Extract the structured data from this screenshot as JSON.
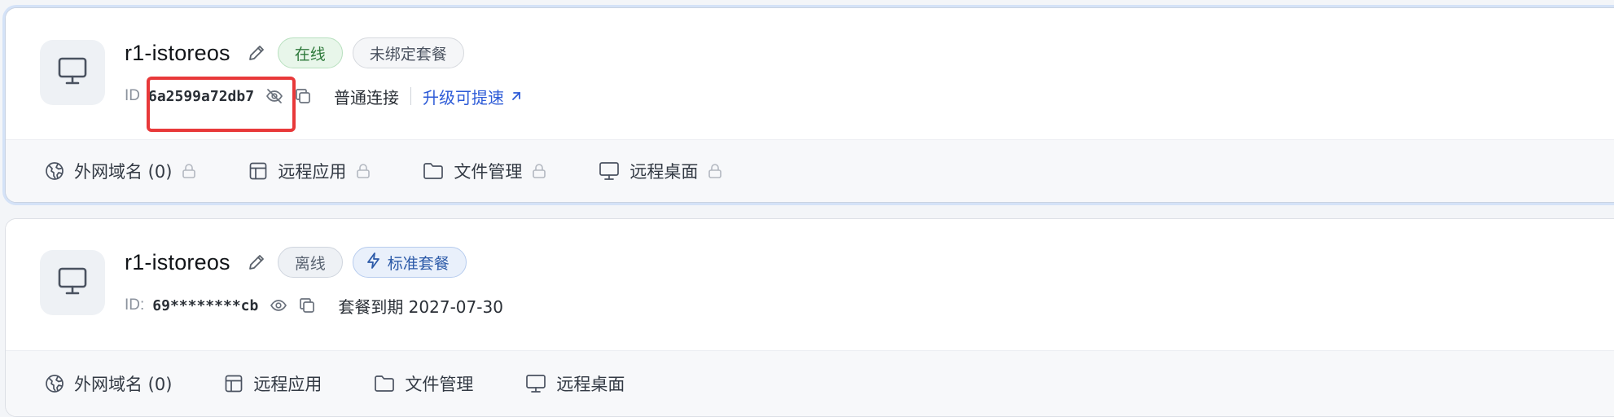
{
  "devices": [
    {
      "name": "r1-istoreos",
      "status": "在线",
      "plan_badge": "未绑定套餐",
      "id_label": "ID",
      "id_value": "6a2599a72db7",
      "connection": "普通连接",
      "upgrade": "升级可提速",
      "actions": {
        "domain": "外网域名 (0)",
        "remote_app": "远程应用",
        "file_manager": "文件管理",
        "remote_desktop": "远程桌面"
      }
    },
    {
      "name": "r1-istoreos",
      "status": "离线",
      "plan_badge": "标准套餐",
      "id_label": "ID:",
      "id_value": "69********cb",
      "expire": "套餐到期 2027-07-30",
      "actions": {
        "domain": "外网域名 (0)",
        "remote_app": "远程应用",
        "file_manager": "文件管理",
        "remote_desktop": "远程桌面"
      }
    }
  ],
  "colors": {
    "online": "#2f7a3c",
    "link": "#2d5bd7",
    "highlight": "#e8393a",
    "plan": "#2c5aa8"
  },
  "icons": [
    "monitor-icon",
    "pencil-icon",
    "eye-off-icon",
    "eye-icon",
    "copy-icon",
    "arrow-up-right-icon",
    "globe-icon",
    "layout-icon",
    "folder-icon",
    "desktop-icon",
    "lock-icon",
    "bolt-icon"
  ]
}
